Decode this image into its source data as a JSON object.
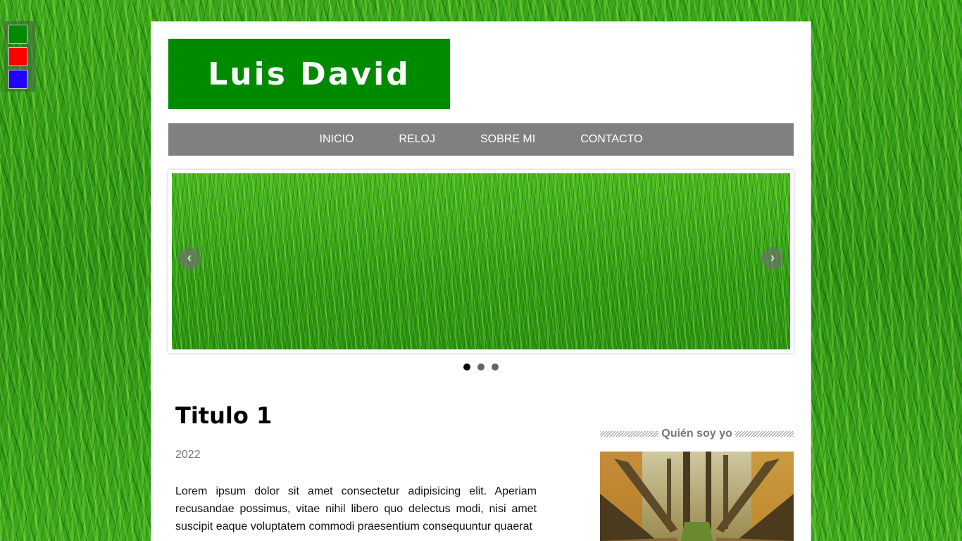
{
  "theme_swatches": [
    {
      "name": "green",
      "color": "#008a00"
    },
    {
      "name": "red",
      "color": "#ff0000"
    },
    {
      "name": "blue",
      "color": "#2200ff"
    }
  ],
  "header": {
    "logo_text": "Luis David",
    "logo_color": "#008a00"
  },
  "nav": {
    "items": [
      {
        "label": "INICIO"
      },
      {
        "label": "RELOJ"
      },
      {
        "label": "SOBRE MI"
      },
      {
        "label": "CONTACTO"
      }
    ],
    "background": "#808080"
  },
  "slider": {
    "prev_icon": "chevron-left-icon",
    "next_icon": "chevron-right-icon",
    "slide_count": 3,
    "active_index": 0
  },
  "post": {
    "title": "Titulo 1",
    "date": "2022",
    "body": "Lorem ipsum dolor sit amet consectetur adipisicing elit. Aperiam recusandae possimus, vitae nihil libero quo delectus modi, nisi amet suscipit eaque voluptatem commodi praesentium consequuntur quaerat"
  },
  "sidebar": {
    "widget_title": "Quién soy yo",
    "photo": "forest-bridge-photo"
  }
}
